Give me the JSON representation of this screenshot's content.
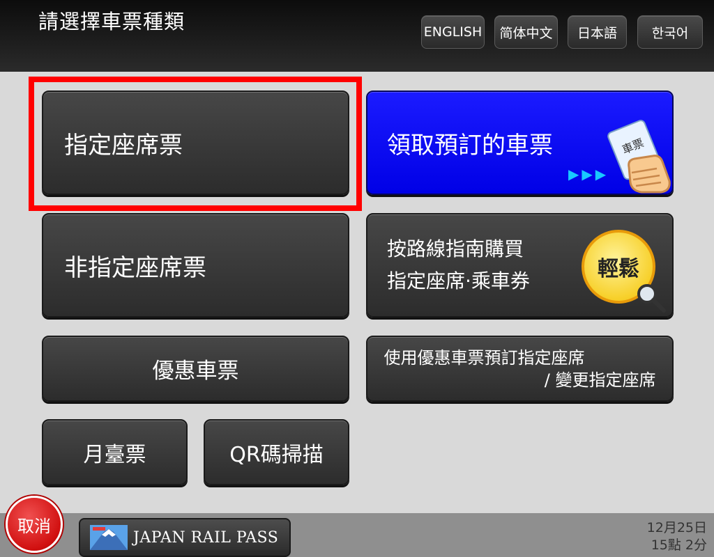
{
  "header": {
    "title": "請選擇車票種類",
    "languages": [
      "ENGLISH",
      "简体中文",
      "日本語",
      "한국어"
    ]
  },
  "menu": {
    "reserved_seat": "指定座席票",
    "pickup_reserved": "領取預訂的車票",
    "pickup_card_label": "車票",
    "non_reserved_seat": "非指定座席票",
    "route_guide_line1": "按路線指南購買",
    "route_guide_line2": "指定座席·乘車券",
    "easy_badge": "輕鬆",
    "discount_ticket": "優惠車票",
    "discount_reserve_line1": "使用優惠車票預訂指定座席",
    "discount_reserve_line2": "/ 變更指定座席",
    "platform_ticket": "月臺票",
    "qr_scan": "QR碼掃描"
  },
  "footer": {
    "cancel": "取消",
    "jr_pass": "JAPAN RAIL PASS",
    "date": "12月25日",
    "time": "15點 2分"
  },
  "colors": {
    "highlight": "#ff0000",
    "blue_button": "#0000f0",
    "badge": "#f7d02a",
    "cancel": "#d11010"
  },
  "icons": [
    "hand-card-icon",
    "arrows-icon",
    "magnifier-icon",
    "mount-fuji-icon"
  ]
}
